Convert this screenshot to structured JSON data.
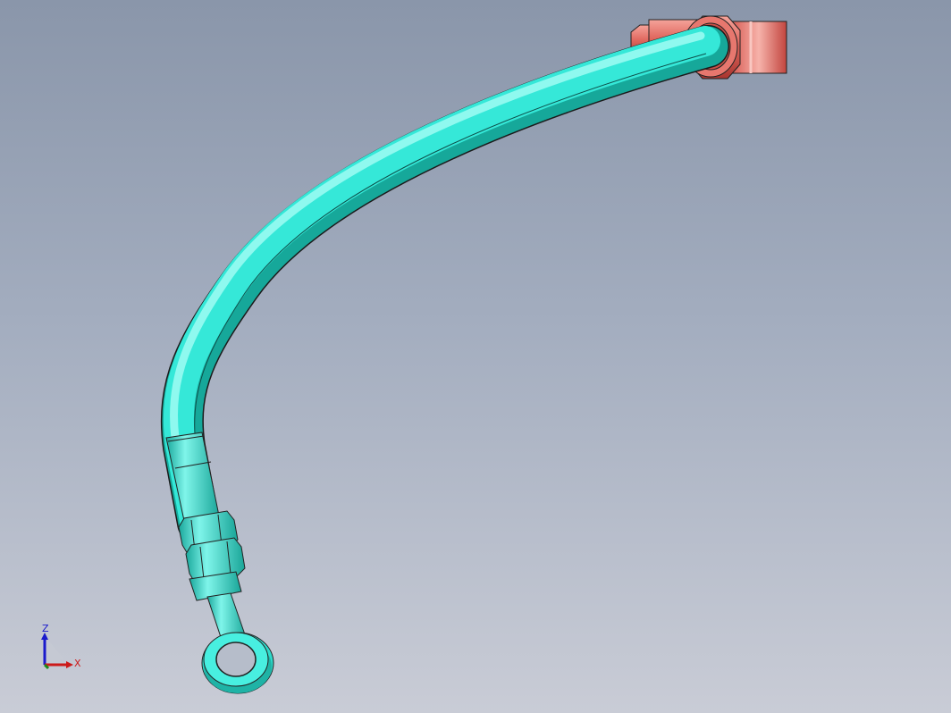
{
  "viewport": {
    "background_top": "#8a96aa",
    "background_bottom": "#c9ccd6"
  },
  "model": {
    "hose_color": "#33e6d6",
    "fitting_color": "#e0675e"
  },
  "triad": {
    "z_label": "Z",
    "x_label": "X",
    "z_color": "#1a1acc",
    "x_color": "#cc1a1a"
  }
}
